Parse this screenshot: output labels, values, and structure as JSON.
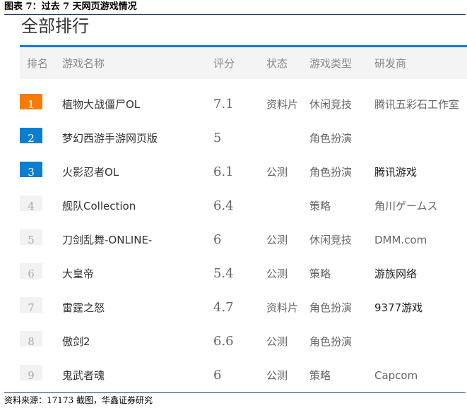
{
  "figure": {
    "caption": "图表 7：过去 7 天网页游戏情况",
    "source": "资料来源：17173 截图，华鑫证券研究"
  },
  "panel": {
    "title": "全部排行",
    "accent_color": "#0a7fcf",
    "headers": {
      "rank": "排名",
      "name": "游戏名称",
      "score": "评分",
      "status": "状态",
      "type": "游戏类型",
      "developer": "研发商"
    },
    "rank_colors": {
      "first": "#f57c0b",
      "second_third": "#0a7fcf",
      "others": "#f2f2f2"
    },
    "rows": [
      {
        "rank": "1",
        "name": "植物大战僵尸OL",
        "score": "7.1",
        "status": "资料片",
        "type": "休闲竞技",
        "developer": "腾讯五彩石工作室"
      },
      {
        "rank": "2",
        "name": "梦幻西游手游网页版",
        "score": "5",
        "status": "",
        "type": "角色扮演",
        "developer": ""
      },
      {
        "rank": "3",
        "name": "火影忍者OL",
        "score": "6.1",
        "status": "公测",
        "type": "角色扮演",
        "developer": "腾讯游戏"
      },
      {
        "rank": "4",
        "name": "舰队Collection",
        "score": "6.4",
        "status": "",
        "type": "策略",
        "developer": "角川ゲームス"
      },
      {
        "rank": "5",
        "name": "刀剑乱舞-ONLINE-",
        "score": "6",
        "status": "公测",
        "type": "休闲竞技",
        "developer": "DMM.com"
      },
      {
        "rank": "6",
        "name": "大皇帝",
        "score": "5.4",
        "status": "公测",
        "type": "策略",
        "developer": "游族网络"
      },
      {
        "rank": "7",
        "name": "雷霆之怒",
        "score": "4.7",
        "status": "资料片",
        "type": "角色扮演",
        "developer": "9377游戏"
      },
      {
        "rank": "8",
        "name": "傲剑2",
        "score": "6.6",
        "status": "公测",
        "type": "角色扮演",
        "developer": ""
      },
      {
        "rank": "9",
        "name": "鬼武者魂",
        "score": "6",
        "status": "公测",
        "type": "策略",
        "developer": "Capcom"
      }
    ]
  }
}
